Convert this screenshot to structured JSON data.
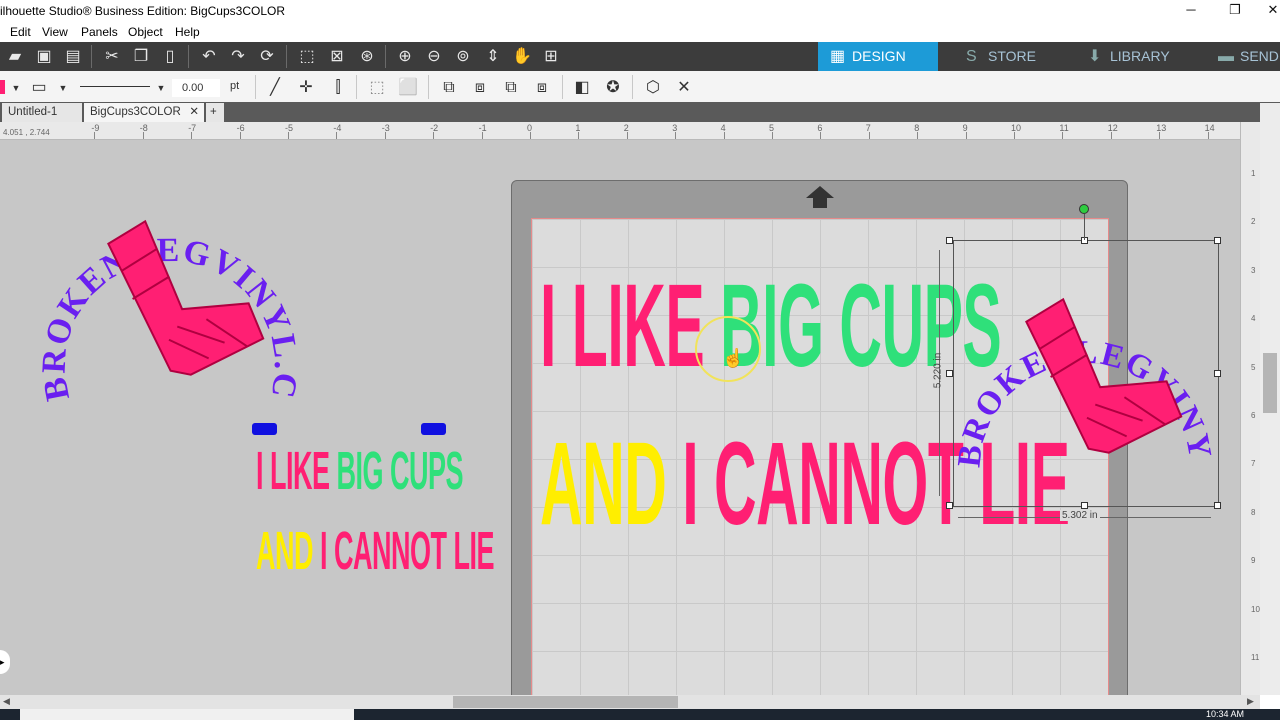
{
  "window": {
    "title": "ilhouette Studio® Business Edition: BigCups3COLOR",
    "minimize": "─",
    "maximize": "❐",
    "close": "✕"
  },
  "menu": [
    "Edit",
    "View",
    "Panels",
    "Object",
    "Help"
  ],
  "nav_tabs": [
    {
      "label": "DESIGN",
      "icon": "grid-icon",
      "glyph": "▦"
    },
    {
      "label": "STORE",
      "icon": "store-icon",
      "glyph": "S"
    },
    {
      "label": "LIBRARY",
      "icon": "library-icon",
      "glyph": "⬇"
    },
    {
      "label": "SEND",
      "icon": "send-icon",
      "glyph": "▬"
    }
  ],
  "line_style": {
    "width_value": "0.00",
    "unit": "pt"
  },
  "doc_tabs": [
    {
      "label": "Untitled-1",
      "close": "✕"
    },
    {
      "label": "BigCups3COLOR",
      "close": "✕"
    }
  ],
  "add_tab": "+",
  "coord_readout": "4.051 , 2.744",
  "ruler_numbers": [
    "-9",
    "-8",
    "-7",
    "-6",
    "-5",
    "-4",
    "-3",
    "-2",
    "-1",
    "0",
    "1",
    "2",
    "3",
    "4",
    "5",
    "6",
    "7",
    "8",
    "9",
    "10",
    "11",
    "12",
    "13",
    "14"
  ],
  "vruler_numbers": [
    "1",
    "2",
    "3",
    "4",
    "5",
    "6",
    "7",
    "8",
    "9",
    "10",
    "11"
  ],
  "design": {
    "logo_text": "BROKENLEGVINYL.COM",
    "line1_a": "I LIKE ",
    "line1_b": "BIG CUPS",
    "line2_a": "AND ",
    "line2_b": "I CANNOT LIE",
    "height_label": "5.220 in",
    "width_label": "5.302 in"
  },
  "colors": {
    "pink": "#ff1f73",
    "green": "#2fe07a",
    "yellow": "#ffee00",
    "purple": "#6a1ff0",
    "blue_marker": "#1010e0",
    "accent": "#1d9bd7"
  },
  "taskbar": {
    "clock": "10:34 AM"
  }
}
